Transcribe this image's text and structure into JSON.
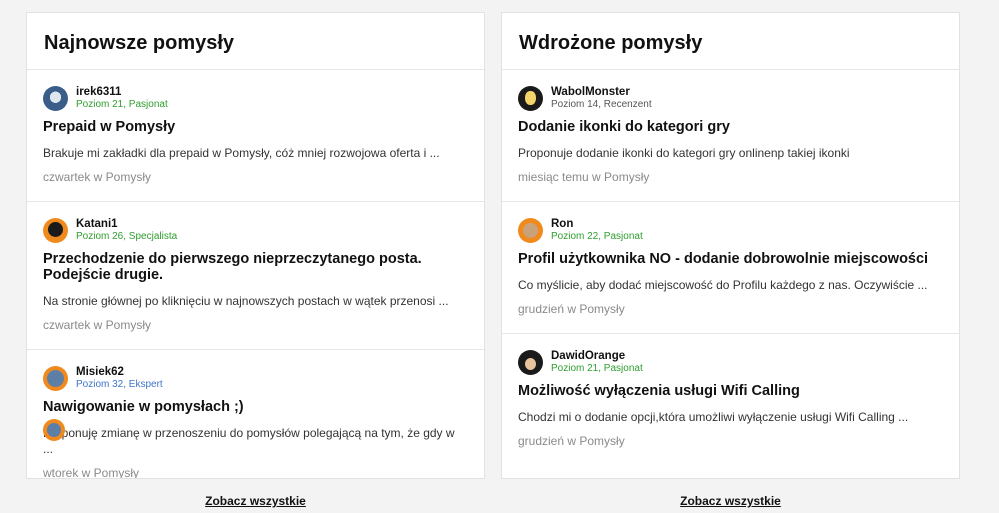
{
  "left": {
    "title": "Najnowsze pomysły",
    "see_all": "Zobacz wszystkie",
    "posts": [
      {
        "author": "irek6311",
        "rank": "Poziom 21, Pasjonat",
        "rank_color": "#2e9e2e",
        "title": "Prepaid w Pomysły",
        "excerpt": "Brakuje mi zakładki dla prepaid w Pomysły, cóż mniej rozwojowa oferta i ...",
        "time": "czwartek w Pomysły"
      },
      {
        "author": "Katani1",
        "rank": "Poziom 26, Specjalista",
        "rank_color": "#2e9e2e",
        "title": "Przechodzenie do pierwszego nieprzeczytanego posta. Podejście drugie.",
        "excerpt": "Na stronie głównej po kliknięciu w najnowszych postach w wątek przenosi ...",
        "time": "czwartek w Pomysły"
      },
      {
        "author": "Misiek62",
        "rank": "Poziom 32, Ekspert",
        "rank_color": "#3f74c9",
        "title": "Nawigowanie w pomysłach ;)",
        "excerpt": "Proponuję zmianę w przenoszeniu do pomysłów polegającą na tym, że gdy w ...",
        "time": "wtorek w Pomysły"
      }
    ]
  },
  "right": {
    "title": "Wdrożone pomysły",
    "see_all": "Zobacz wszystkie",
    "posts": [
      {
        "author": "WabolMonster",
        "rank": "Poziom 14, Recenzent",
        "rank_color": "#555555",
        "title": "Dodanie ikonki do kategori gry",
        "excerpt": "Proponuje dodanie ikonki do kategori gry onlinenp takiej ikonki",
        "time": "miesiąc temu w Pomysły"
      },
      {
        "author": "Ron",
        "rank": "Poziom 22, Pasjonat",
        "rank_color": "#2e9e2e",
        "title": "Profil użytkownika NO - dodanie dobrowolnie miejscowości",
        "excerpt": "Co myślicie, aby dodać miejscowość do Profilu każdego z nas. Oczywiście ...",
        "time": "grudzień w Pomysły"
      },
      {
        "author": "DawidOrange",
        "rank": "Poziom 21, Pasjonat",
        "rank_color": "#2e9e2e",
        "title": "Możliwość wyłączenia usługi Wifi Calling",
        "excerpt": "Chodzi mi o dodanie opcji,która umożliwi wyłączenie usługi Wifi Calling ...",
        "time": "grudzień w Pomysły"
      }
    ]
  }
}
